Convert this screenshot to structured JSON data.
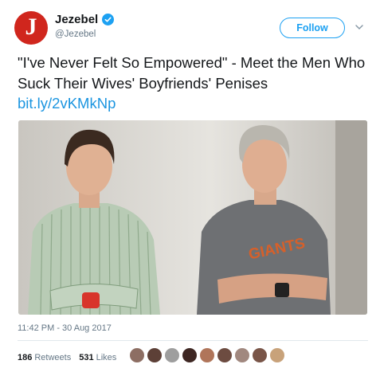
{
  "account": {
    "avatar_letter": "J",
    "display_name": "Jezebel",
    "handle": "@Jezebel",
    "verified": true,
    "brand_color": "#d0261d"
  },
  "follow_button": {
    "label": "Follow",
    "accent": "#1da1f2"
  },
  "tweet": {
    "text": "\"I've Never Felt So Empowered\" - Meet the Men Who Suck Their Wives' Boyfriends' Penises ",
    "link": "bit.ly/2vKMkNp"
  },
  "photo": {
    "shirt_print": "GIANTS"
  },
  "timestamp": "11:42 PM - 30 Aug 2017",
  "stats": {
    "retweets_count": "186",
    "retweets_label": "Retweets",
    "likes_count": "531",
    "likes_label": "Likes"
  },
  "liker_avatars": [
    "#8d6e63",
    "#5d4037",
    "#9e9e9e",
    "#3e2723",
    "#b0755a",
    "#6d4c41",
    "#a1887f",
    "#795548",
    "#c8a27a"
  ]
}
